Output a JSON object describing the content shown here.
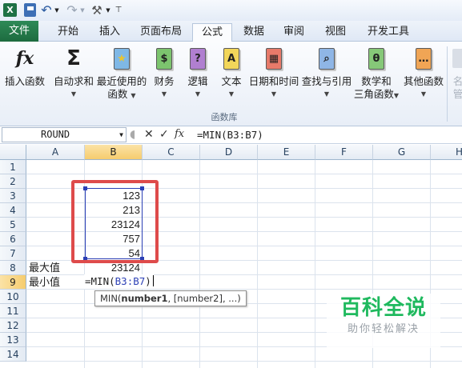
{
  "quick_access": {
    "icons": [
      "excel-logo",
      "save",
      "undo",
      "redo",
      "customize"
    ],
    "excel_glyph": "X",
    "undo_glyph": "↶",
    "redo_glyph": "↷",
    "customize_glyph": "⚒"
  },
  "tabs": [
    "文件",
    "开始",
    "插入",
    "页面布局",
    "公式",
    "数据",
    "审阅",
    "视图",
    "开发工具"
  ],
  "active_tab": "公式",
  "ribbon": {
    "group_label": "函数库",
    "buttons": [
      {
        "label": "插入函数",
        "label2": "",
        "icon": "fx-icon",
        "glyph": "fx",
        "caret": false
      },
      {
        "label": "自动求和",
        "label2": "",
        "icon": "sigma-icon",
        "glyph": "Σ",
        "caret": true
      },
      {
        "label": "最近使用的",
        "label2": "函数",
        "icon": "star-book-icon",
        "glyph": "★",
        "caret": true
      },
      {
        "label": "财务",
        "label2": "",
        "icon": "finance-book-icon",
        "glyph": "$",
        "caret": true
      },
      {
        "label": "逻辑",
        "label2": "",
        "icon": "logic-book-icon",
        "glyph": "?",
        "caret": true
      },
      {
        "label": "文本",
        "label2": "",
        "icon": "text-book-icon",
        "glyph": "A",
        "caret": true
      },
      {
        "label": "日期和时间",
        "label2": "",
        "icon": "calendar-book-icon",
        "glyph": "▦",
        "caret": true
      },
      {
        "label": "查找与引用",
        "label2": "",
        "icon": "lookup-book-icon",
        "glyph": "⌕",
        "caret": true
      },
      {
        "label": "数学和",
        "label2": "三角函数",
        "icon": "math-book-icon",
        "glyph": "θ",
        "caret": true
      },
      {
        "label": "其他函数",
        "label2": "",
        "icon": "more-book-icon",
        "glyph": "…",
        "caret": true
      },
      {
        "label": "名",
        "label2": "管",
        "icon": "name-manager-icon",
        "glyph": "",
        "caret": false
      }
    ],
    "colors": {
      "finance": "#4fa34a",
      "logic": "#8a4aa8",
      "text": "#e8c431",
      "calendar": "#d84a3a",
      "lookup": "#4a7ec8",
      "math": "#5aa84a",
      "more": "#e08a2a",
      "recent": "#3a8ad0"
    }
  },
  "formula_bar": {
    "name_box": "ROUND",
    "cancel_glyph": "✕",
    "enter_glyph": "✓",
    "fx_glyph": "fx",
    "formula": "=MIN(B3:B7)"
  },
  "columns": [
    "A",
    "B",
    "C",
    "D",
    "E",
    "F",
    "G",
    "H"
  ],
  "selected_column": "B",
  "rows": [
    "1",
    "2",
    "3",
    "4",
    "5",
    "6",
    "7",
    "8",
    "9",
    "10",
    "11",
    "12",
    "13",
    "14"
  ],
  "selected_row": "9",
  "cells": {
    "B3": "123",
    "B4": "213",
    "B5": "23124",
    "B6": "757",
    "B7": "54",
    "A8": "最大值",
    "B8": "23124",
    "A9": "最小值"
  },
  "editing": {
    "prefix": "=MIN(",
    "ref": "B3:B7",
    "suffix": ")"
  },
  "tooltip": {
    "fn": "MIN(",
    "arg1": "number1",
    "rest": ", [number2], ...)"
  },
  "watermark": {
    "title": "百科全说",
    "subtitle": "助你轻松解决"
  },
  "colors": {
    "file_tab": "#1d6b3f",
    "range_border": "#2b3fb5",
    "highlight_box": "#de4b4b",
    "watermark_green": "#1fb95e"
  }
}
